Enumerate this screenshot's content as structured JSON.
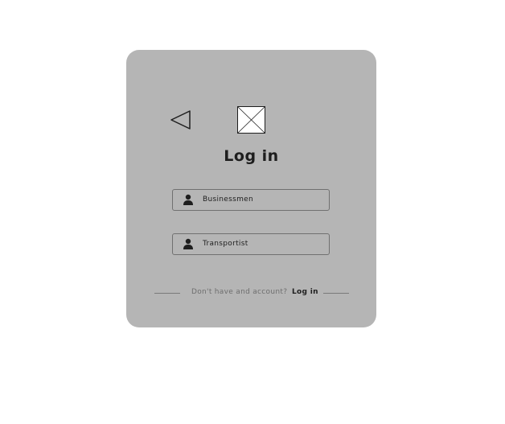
{
  "login_card": {
    "title": "Log in",
    "back_icon": "triangle-back-icon",
    "logo_icon": "image-placeholder-icon",
    "roles": [
      {
        "label": "Businessmen",
        "icon": "user-icon"
      },
      {
        "label": "Transportist",
        "icon": "user-icon"
      }
    ],
    "footer": {
      "prompt": "Don't have and account?",
      "link_label": "Log in"
    }
  },
  "colors": {
    "card_background": "#b5b5b5",
    "page_background": "#ffffff",
    "text_dark": "#1e1e1e",
    "text_muted": "#6e6e6e",
    "border": "#707070"
  }
}
